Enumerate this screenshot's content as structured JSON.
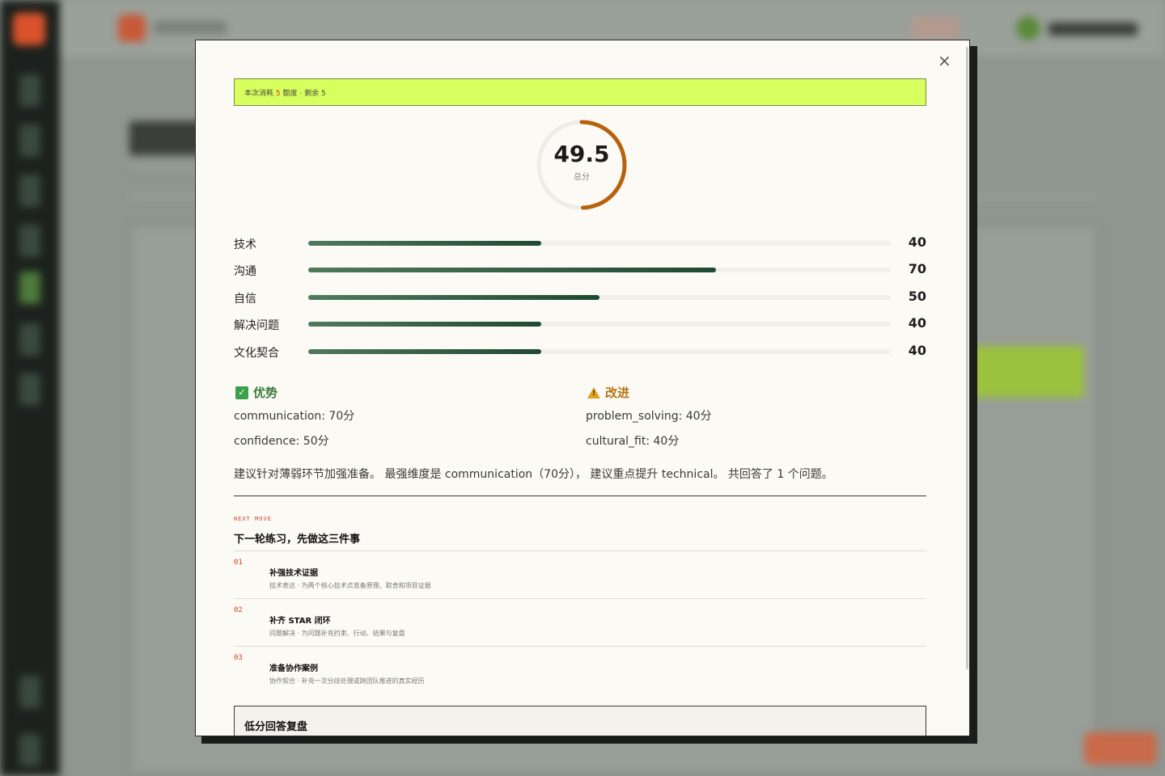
{
  "modal": {
    "close_icon": "×",
    "quota": {
      "prefix": "本次消耗",
      "cost": "5",
      "suffix": "额度 · 剩余 5"
    },
    "score": {
      "value": "49.5",
      "label": "总分",
      "percent": 49.5
    },
    "dimensions": [
      {
        "label": "技术",
        "value": 40
      },
      {
        "label": "沟通",
        "value": 70
      },
      {
        "label": "自信",
        "value": 50
      },
      {
        "label": "解决问题",
        "value": 40
      },
      {
        "label": "文化契合",
        "value": 40
      }
    ],
    "strengths": {
      "title": "优势",
      "icon": "check-icon",
      "items": [
        "communication: 70分",
        "confidence: 50分"
      ]
    },
    "improvements": {
      "title": "改进",
      "icon": "warning-icon",
      "items": [
        "problem_solving: 40分",
        "cultural_fit: 40分"
      ]
    },
    "summary": "建议针对薄弱环节加强准备。 最强维度是 communication（70分）， 建议重点提升 technical。 共回答了 1 个问题。",
    "next_move": {
      "tag": "NEXT MOVE",
      "title": "下一轮练习，先做这三件事",
      "steps": [
        {
          "no": "01",
          "title": "补强技术证据",
          "desc": "技术表达 · 为两个核心技术点准备原理、取舍和项目证据"
        },
        {
          "no": "02",
          "title": "补齐 STAR 闭环",
          "desc": "问题解决 · 为问题补充约束、行动、结果与复盘"
        },
        {
          "no": "03",
          "title": "准备协作案例",
          "desc": "协作契合 · 补充一次分歧处理或跨团队推进的真实经历"
        }
      ]
    },
    "low_score_review": {
      "title": "低分回答复盘"
    }
  },
  "colors": {
    "quota_bg": "#d7ff5e",
    "ring": "#b8620e",
    "bar": "#1f4a32",
    "strength": "#3d7a3e",
    "warning": "#b8750f",
    "accent_red": "#d2412a"
  }
}
